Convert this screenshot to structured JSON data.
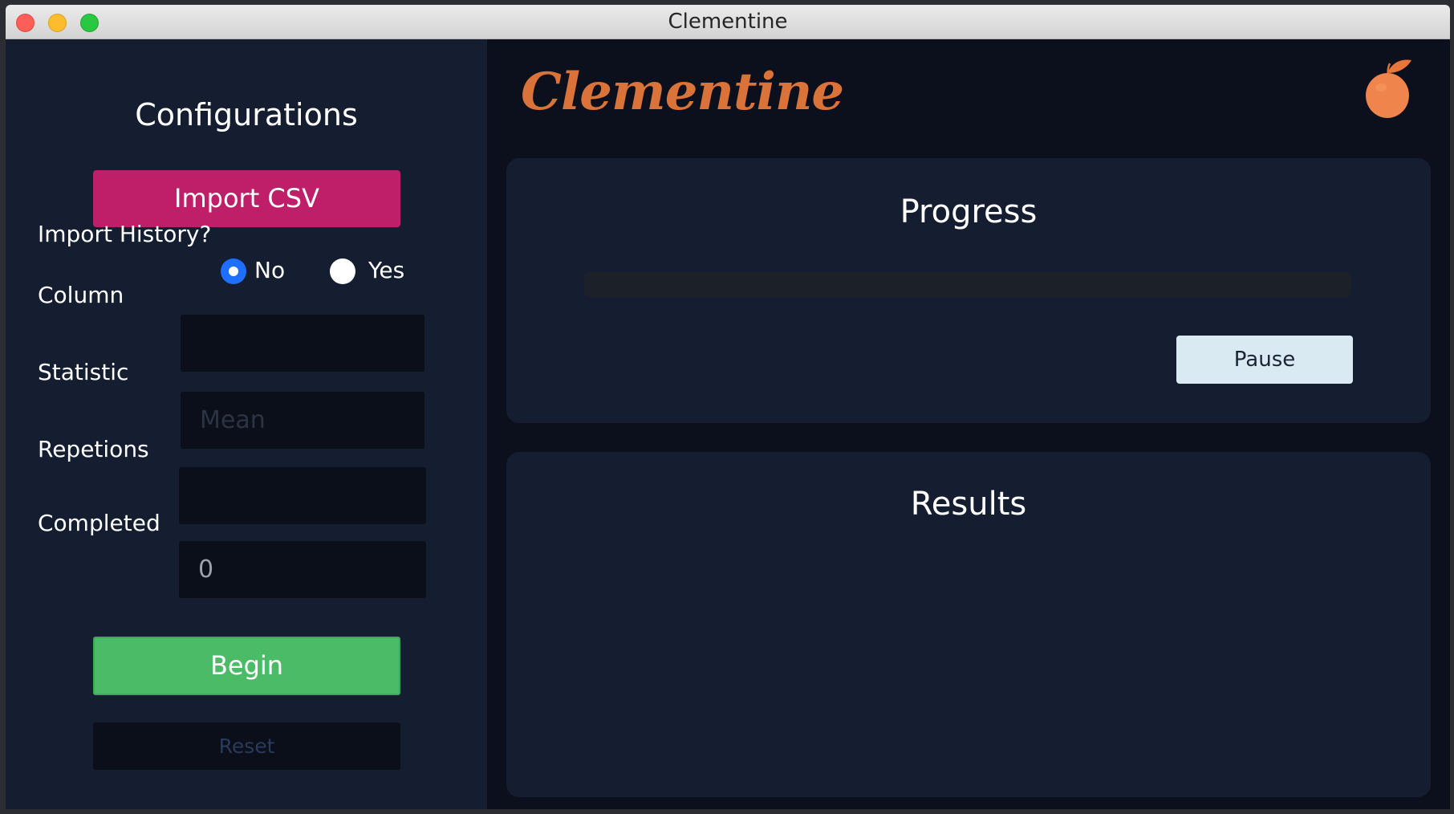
{
  "window": {
    "title": "Clementine"
  },
  "sidebar": {
    "title": "Configurations",
    "import_button_label": "Import CSV",
    "import_history": {
      "label": "Import History?",
      "options": [
        {
          "label": "No",
          "selected": true
        },
        {
          "label": "Yes",
          "selected": false
        }
      ]
    },
    "fields": {
      "column": {
        "label": "Column",
        "value": "",
        "placeholder": ""
      },
      "statistic": {
        "label": "Statistic",
        "value": "",
        "placeholder": "Mean"
      },
      "repetitions": {
        "label": "Repetions",
        "value": "",
        "placeholder": ""
      },
      "completed": {
        "label": "Completed",
        "value": "0",
        "placeholder": ""
      }
    },
    "begin_label": "Begin",
    "reset_label": "Reset"
  },
  "main": {
    "brand": "Clementine",
    "logo_icon": "clementine-fruit-icon",
    "progress": {
      "title": "Progress",
      "value": 0,
      "pause_label": "Pause"
    },
    "results": {
      "title": "Results"
    }
  },
  "colors": {
    "import_button": "#bf1f68",
    "begin_button": "#4cbb68",
    "brand": "#d9733a",
    "radio_selected": "#1f6fff",
    "pause_button": "#d9eaf2"
  }
}
